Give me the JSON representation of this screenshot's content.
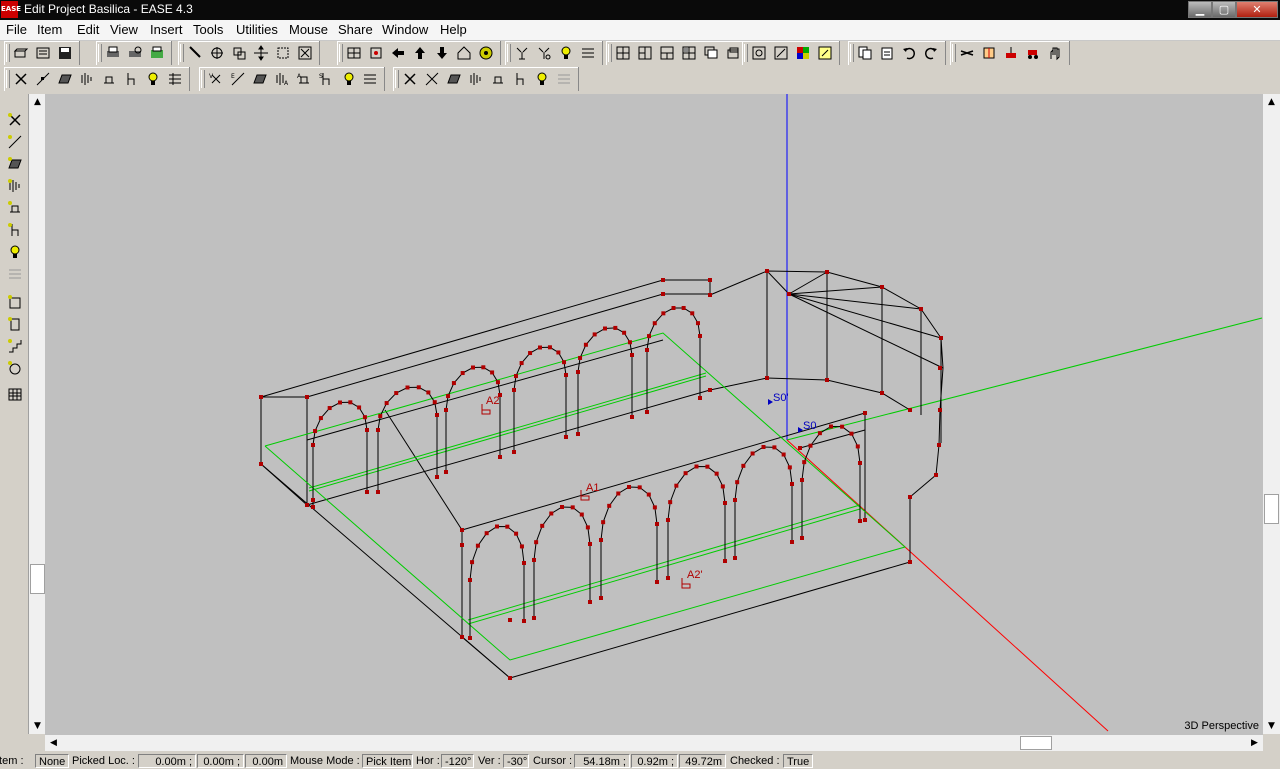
{
  "window": {
    "title": "Edit Project Basilica - EASE 4.3",
    "logo": "EASE"
  },
  "menu": [
    "File",
    "Item",
    "Edit",
    "View",
    "Insert",
    "Tools",
    "Utilities",
    "Mouse",
    "Share",
    "Window",
    "Help"
  ],
  "viewport": {
    "label": "3D Perspective",
    "background": "#c0c0c0",
    "axis_colors": {
      "z": "#0000ff",
      "x": "#ff0000",
      "y": "#00cc00"
    },
    "wire_color": "#000000",
    "vertex_color": "#b00000",
    "annotation_color_audience": "#b00000",
    "annotation_color_source": "#0000c0",
    "annotations": [
      "A2",
      "A1",
      "A2'",
      "S0'",
      "S0"
    ]
  },
  "status": {
    "item_label": "Item :",
    "item_value": "None",
    "picked_label": "Picked Loc. :",
    "picked_x": "0.00m ;",
    "picked_y": "0.00m ;",
    "picked_z": "0.00m",
    "mode_label": "Mouse Mode :",
    "mode_value": "Pick Item",
    "hor_label": "Hor :",
    "hor_value": "-120°",
    "ver_label": "Ver :",
    "ver_value": "-30°",
    "cursor_label": "Cursor :",
    "cursor_x": "54.18m ;",
    "cursor_y": "0.92m ;",
    "cursor_z": "49.72m",
    "checked_label": "Checked :",
    "checked_value": "True"
  }
}
